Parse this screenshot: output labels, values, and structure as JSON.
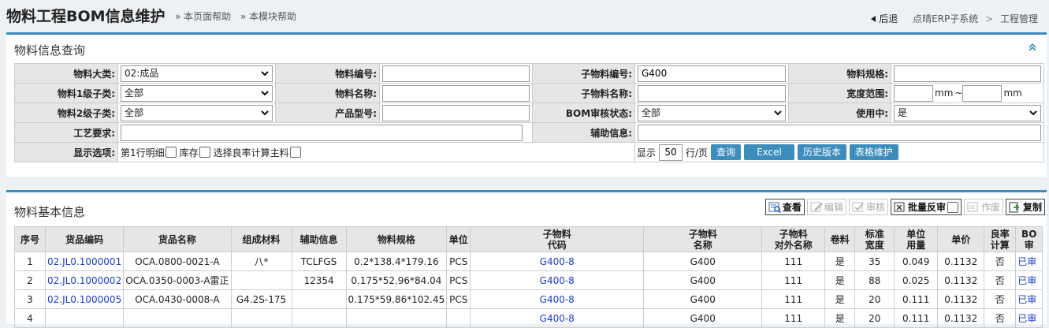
{
  "header": {
    "title": "物料工程BOM信息维护",
    "help_page": "» 本页面帮助",
    "help_module": "» 本模块帮助",
    "back": "后退",
    "crumb1": "点晴ERP子系统",
    "crumb_sep": ">",
    "crumb2": "工程管理"
  },
  "query_panel": {
    "title": "物料信息查询",
    "labels": {
      "category": "物料大类:",
      "material_no": "物料编号:",
      "child_no": "子物料编号:",
      "spec": "物料规格:",
      "sub1": "物料1级子类:",
      "name": "物料名称:",
      "child_name": "子物料名称:",
      "width_range": "宽度范围:",
      "sub2": "物料2级子类:",
      "product_model": "产品型号:",
      "bom_status": "BOM审核状态:",
      "in_use": "使用中:",
      "process_req": "工艺要求:",
      "aux_info": "辅助信息:",
      "display_options": "显示选项:"
    },
    "values": {
      "category": "02:成品",
      "material_no": "",
      "child_no": "G400",
      "spec": "",
      "sub1": "全部",
      "name": "",
      "child_name": "",
      "width_from": "",
      "width_to": "",
      "sub2": "全部",
      "product_model": "",
      "bom_status": "全部",
      "in_use": "是",
      "process_req": "",
      "aux_info": ""
    },
    "unit_mm": "mm",
    "tilde": "~",
    "options": {
      "first_row_detail": "第1行明细",
      "stock": "库存",
      "yield_main": "选择良率计算主料"
    },
    "pager": {
      "show": "显示",
      "rows": "50",
      "per_page": "行/页"
    },
    "buttons": {
      "query": "查询",
      "excel": "Excel",
      "history": "历史版本",
      "table_maint": "表格维护"
    }
  },
  "data_panel": {
    "title": "物料基本信息",
    "toolbar": {
      "view": "查看",
      "edit": "编辑",
      "audit": "审核",
      "batch_unaudit": "批量反审",
      "void": "作废",
      "copy": "复制"
    },
    "columns": [
      [
        "序号"
      ],
      [
        "货品编码"
      ],
      [
        "货品名称"
      ],
      [
        "组成材料"
      ],
      [
        "辅助信息"
      ],
      [
        "物料规格"
      ],
      [
        "单位"
      ],
      [
        "子物料",
        "代码"
      ],
      [
        "子物料",
        "名称"
      ],
      [
        "子物料",
        "对外名称"
      ],
      [
        "卷料"
      ],
      [
        "标准",
        "宽度"
      ],
      [
        "单位",
        "用量"
      ],
      [
        "单价"
      ],
      [
        "良率",
        "计算"
      ],
      [
        "BO",
        "审"
      ]
    ],
    "rows": [
      [
        "1",
        "02.JL0.1000001",
        "OCA.0800-0021-A",
        "八*",
        "TCLFGS",
        "0.2*138.4*179.16",
        "PCS",
        "G400-8",
        "G400",
        "111",
        "是",
        "35",
        "0.049",
        "0.1132",
        "否",
        "已审"
      ],
      [
        "2",
        "02.JL0.1000002",
        "OCA.0350-0003-A雷正",
        "",
        "12354",
        "0.175*52.96*84.04",
        "PCS",
        "G400-8",
        "G400",
        "111",
        "是",
        "88",
        "0.025",
        "0.1132",
        "否",
        "已审"
      ],
      [
        "3",
        "02.JL0.1000005",
        "OCA.0430-0008-A",
        "G4.2S-175",
        "",
        "0.175*59.86*102.45",
        "PCS",
        "G400-8",
        "G400",
        "111",
        "是",
        "20",
        "0.111",
        "0.1132",
        "否",
        "已审"
      ],
      [
        "4",
        "",
        "",
        "",
        "",
        "",
        "",
        "G400-8",
        "G400",
        "111",
        "是",
        "20",
        "0.111",
        "0.1132",
        "否",
        "已审"
      ]
    ]
  }
}
